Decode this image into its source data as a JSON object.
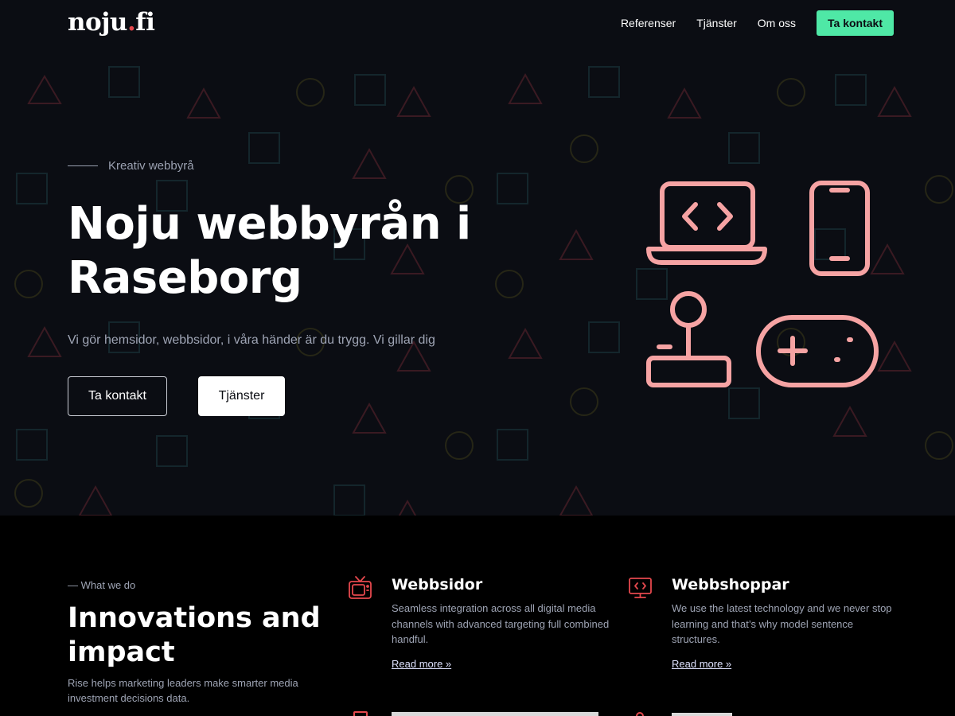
{
  "brand": {
    "logo_main": "noju",
    "logo_dot": ".",
    "logo_tld": "fi",
    "accent": "#4fe8a6",
    "logo_dot_color": "#e5484d",
    "icon_color": "#f6a3a3"
  },
  "nav": {
    "links": [
      "Referenser",
      "Tjänster",
      "Om oss"
    ],
    "cta": "Ta kontakt"
  },
  "hero": {
    "eyebrow": "Kreativ webbyrå",
    "title": "Noju webbyrån i Raseborg",
    "subtitle": "Vi gör hemsidor, webbsidor, i våra händer är du trygg. Vi gillar dig",
    "btn_primary": "Ta kontakt",
    "btn_secondary": "Tjänster",
    "illustration_icons": [
      "laptop-code-icon",
      "smartphone-icon",
      "joystick-icon",
      "gamepad-icon"
    ]
  },
  "section": {
    "label": "— What we do",
    "title": "Innovations and impact",
    "description": "Rise helps marketing leaders make smarter media investment decisions data.",
    "services": [
      {
        "icon": "tv-icon",
        "title": "Webbsidor",
        "description": "Seamless integration across all digital media channels with advanced targeting full combined handful.",
        "link": "Read more »"
      },
      {
        "icon": "monitor-code-icon",
        "title": "Webbshoppar",
        "description": "We use the latest technology and we never stop learning and that’s why model sentence structures.",
        "link": "Read more »"
      }
    ]
  }
}
